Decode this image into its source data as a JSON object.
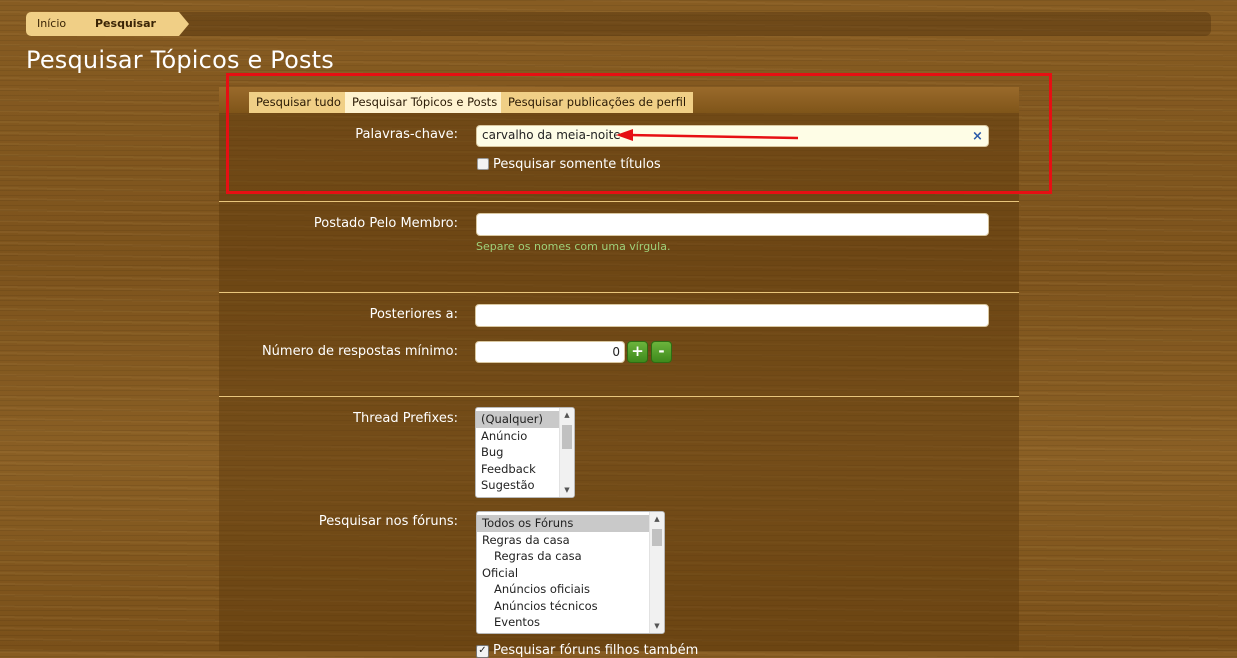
{
  "breadcrumb": {
    "home": "Início",
    "current": "Pesquisar"
  },
  "page_title": "Pesquisar Tópicos e Posts",
  "tabs": [
    {
      "label": "Pesquisar tudo"
    },
    {
      "label": "Pesquisar Tópicos e Posts"
    },
    {
      "label": "Pesquisar publicações de perfil"
    }
  ],
  "keywords": {
    "label": "Palavras-chave:",
    "value": "carvalho da meia-noite",
    "clear_icon": "×"
  },
  "titles_only": {
    "label": "Pesquisar somente títulos",
    "checked": false
  },
  "member": {
    "label": "Postado Pelo Membro:",
    "value": "",
    "hint": "Separe os nomes com uma vírgula."
  },
  "newer_than": {
    "label": "Posteriores a:",
    "value": ""
  },
  "min_replies": {
    "label": "Número de respostas mínimo:",
    "value": "0",
    "plus": "+",
    "minus": "-"
  },
  "prefixes": {
    "label": "Thread Prefixes:",
    "options": [
      "(Qualquer)",
      "Anúncio",
      "Bug",
      "Feedback",
      "Sugestão"
    ]
  },
  "forums": {
    "label": "Pesquisar nos fóruns:",
    "options": [
      "Todos os Fóruns",
      "Regras da casa",
      "Regras da casa",
      "Oficial",
      "Anúncios oficiais",
      "Anúncios técnicos",
      "Eventos"
    ]
  },
  "bottom_check": {
    "label": "Pesquisar fóruns filhos também",
    "checked": true
  },
  "colors": {
    "accent": "#f0cf86",
    "annotation": "#e60f13",
    "hint": "#9fd07a",
    "step_button": "#4c9a27"
  }
}
